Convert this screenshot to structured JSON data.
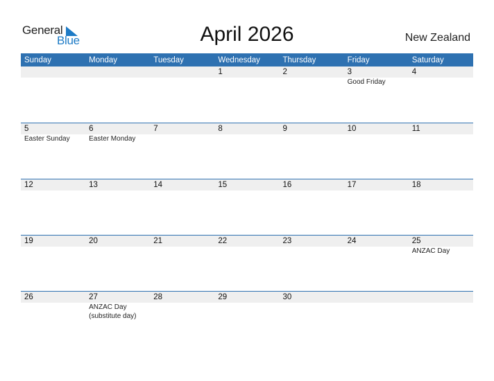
{
  "logo": {
    "line1": "General",
    "line2": "Blue"
  },
  "title": "April 2026",
  "country": "New Zealand",
  "colors": {
    "header_bg": "#2e71b1",
    "accent": "#1e7bc6",
    "day_strip": "#efefef"
  },
  "weekdays": [
    "Sunday",
    "Monday",
    "Tuesday",
    "Wednesday",
    "Thursday",
    "Friday",
    "Saturday"
  ],
  "weeks": [
    {
      "days": [
        {
          "num": "",
          "holiday": ""
        },
        {
          "num": "",
          "holiday": ""
        },
        {
          "num": "",
          "holiday": ""
        },
        {
          "num": "1",
          "holiday": ""
        },
        {
          "num": "2",
          "holiday": ""
        },
        {
          "num": "3",
          "holiday": "Good Friday"
        },
        {
          "num": "4",
          "holiday": ""
        }
      ]
    },
    {
      "days": [
        {
          "num": "5",
          "holiday": "Easter Sunday"
        },
        {
          "num": "6",
          "holiday": "Easter Monday"
        },
        {
          "num": "7",
          "holiday": ""
        },
        {
          "num": "8",
          "holiday": ""
        },
        {
          "num": "9",
          "holiday": ""
        },
        {
          "num": "10",
          "holiday": ""
        },
        {
          "num": "11",
          "holiday": ""
        }
      ]
    },
    {
      "days": [
        {
          "num": "12",
          "holiday": ""
        },
        {
          "num": "13",
          "holiday": ""
        },
        {
          "num": "14",
          "holiday": ""
        },
        {
          "num": "15",
          "holiday": ""
        },
        {
          "num": "16",
          "holiday": ""
        },
        {
          "num": "17",
          "holiday": ""
        },
        {
          "num": "18",
          "holiday": ""
        }
      ]
    },
    {
      "days": [
        {
          "num": "19",
          "holiday": ""
        },
        {
          "num": "20",
          "holiday": ""
        },
        {
          "num": "21",
          "holiday": ""
        },
        {
          "num": "22",
          "holiday": ""
        },
        {
          "num": "23",
          "holiday": ""
        },
        {
          "num": "24",
          "holiday": ""
        },
        {
          "num": "25",
          "holiday": "ANZAC Day"
        }
      ]
    },
    {
      "days": [
        {
          "num": "26",
          "holiday": ""
        },
        {
          "num": "27",
          "holiday": "ANZAC Day (substitute day)"
        },
        {
          "num": "28",
          "holiday": ""
        },
        {
          "num": "29",
          "holiday": ""
        },
        {
          "num": "30",
          "holiday": ""
        },
        {
          "num": "",
          "holiday": ""
        },
        {
          "num": "",
          "holiday": ""
        }
      ]
    }
  ]
}
